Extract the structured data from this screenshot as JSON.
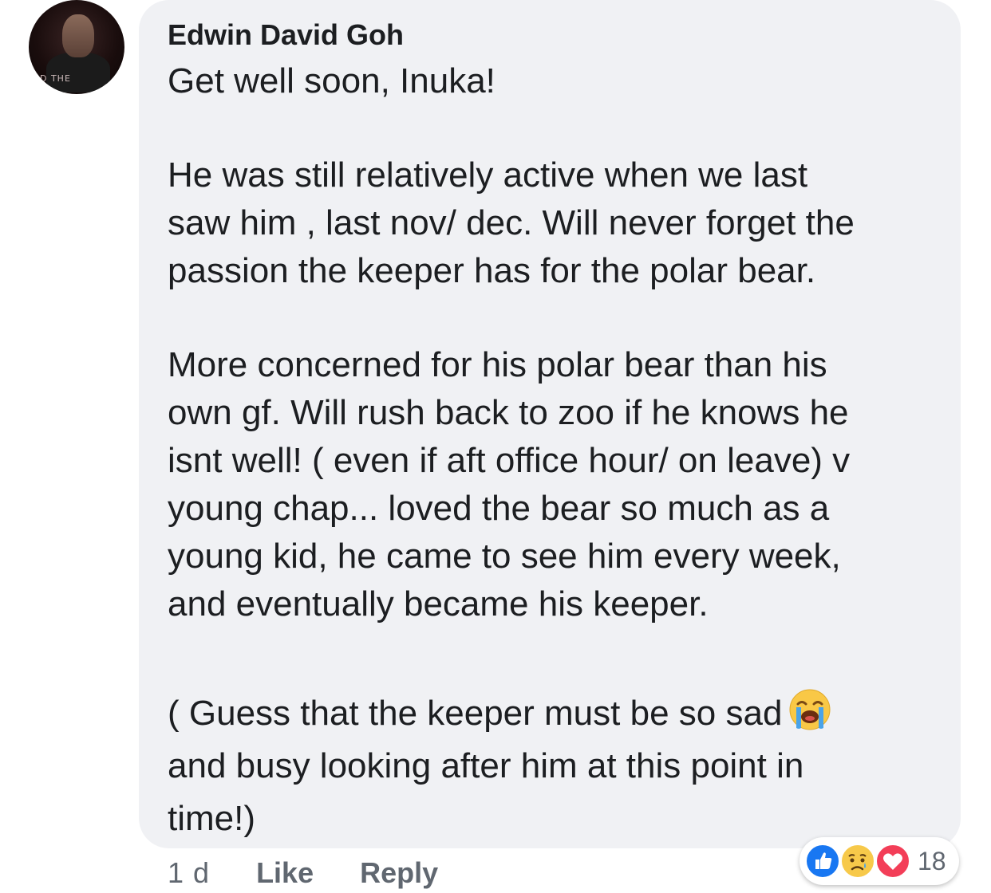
{
  "comment": {
    "author": "Edwin David Goh",
    "avatar_overlay_text": "D THE",
    "paragraphs": [
      [
        "Get well soon, Inuka!"
      ],
      [
        "He was still relatively active when we last",
        "saw him , last nov/ dec. Will never forget the",
        "passion the keeper has for the polar bear."
      ],
      [
        "More concerned for his polar bear than his",
        "own gf. Will rush back to zoo if he knows he",
        "isnt well! ( even if aft office hour/ on leave) v",
        "young chap... loved the bear so much as a",
        "young kid, he came to see him every week,",
        "and eventually became his keeper."
      ],
      [
        "( Guess that the keeper must be so sad",
        "and busy looking after him at this point in",
        "time!)"
      ]
    ],
    "emoji": "loudly-crying-face"
  },
  "meta": {
    "time": "1 d",
    "like_label": "Like",
    "reply_label": "Reply"
  },
  "reactions": {
    "types": [
      "like-icon",
      "sad-icon",
      "love-icon"
    ],
    "count": "18",
    "colors": {
      "like": "#1877f2",
      "sad": "#f7c94a",
      "love": "#f33e58"
    }
  },
  "colors": {
    "bubble_background": "#f0f1f4",
    "text": "#1c1e21",
    "secondary_text": "#606770"
  }
}
